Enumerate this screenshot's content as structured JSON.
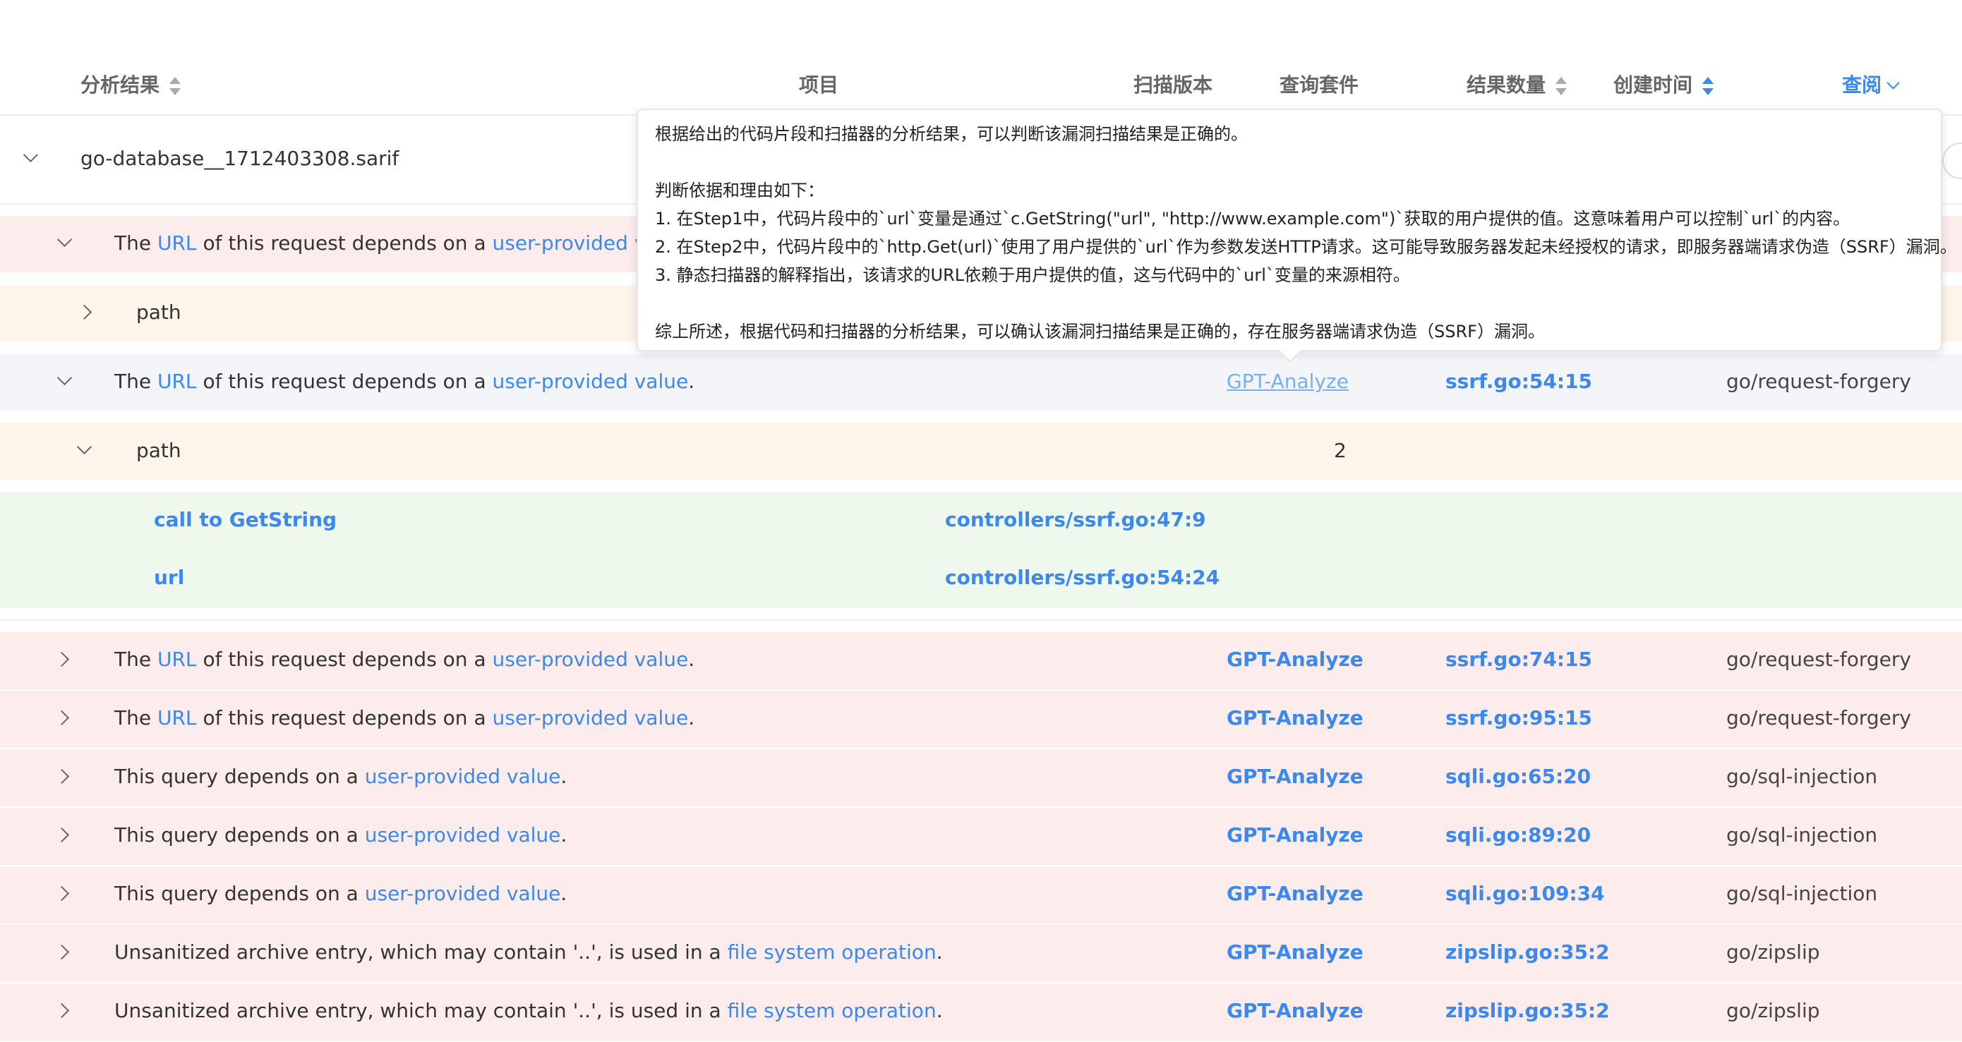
{
  "header": {
    "analysis_result": "分析结果",
    "project": "项目",
    "scan_version": "扫描版本",
    "query_suite": "查询套件",
    "result_count": "结果数量",
    "created_time": "创建时间",
    "view": "查阅"
  },
  "file": {
    "name": "go-database__1712403308.sarif"
  },
  "tooltip": {
    "lines": [
      "根据给出的代码片段和扫描器的分析结果，可以判断该漏洞扫描结果是正确的。",
      "判断依据和理由如下：",
      "1. 在Step1中，代码片段中的`url`变量是通过`c.GetString(\"url\", \"http://www.example.com\")`获取的用户提供的值。这意味着用户可以控制`url`的内容。",
      "2. 在Step2中，代码片段中的`http.Get(url)`使用了用户提供的`url`作为参数发送HTTP请求。这可能导致服务器发起未经授权的请求，即服务器端请求伪造（SSRF）漏洞。",
      "3. 静态扫描器的解释指出，该请求的URL依赖于用户提供的值，这与代码中的`url`变量的来源相符。",
      "综上所述，根据代码和扫描器的分析结果，可以确认该漏洞扫描结果是正确的，存在服务器端请求伪造（SSRF）漏洞。"
    ]
  },
  "result1": {
    "text_the": "The",
    "text_url": "URL",
    "text_mid": "of this request depends on a",
    "text_upv": "user-provided va"
  },
  "path1": {
    "label": "path"
  },
  "result2": {
    "text_the": "The",
    "text_url": "URL",
    "text_mid": "of this request depends on a",
    "text_upv": "user-provided value",
    "dot": ".",
    "analyze": "GPT-Analyze",
    "location": "ssrf.go:54:15",
    "rule": "go/request-forgery"
  },
  "path2": {
    "label": "path",
    "count": "2",
    "steps": [
      {
        "name": "call to GetString",
        "location": "controllers/ssrf.go:47:9"
      },
      {
        "name": "url",
        "location": "controllers/ssrf.go:54:24"
      }
    ]
  },
  "results": [
    {
      "pre": "The",
      "link1": "URL",
      "mid": "of this request depends on a",
      "link2": "user-provided value",
      "dot": ".",
      "analyze": "GPT-Analyze",
      "location": "ssrf.go:74:15",
      "rule": "go/request-forgery"
    },
    {
      "pre": "The",
      "link1": "URL",
      "mid": "of this request depends on a",
      "link2": "user-provided value",
      "dot": ".",
      "analyze": "GPT-Analyze",
      "location": "ssrf.go:95:15",
      "rule": "go/request-forgery"
    },
    {
      "pre": "This query depends on a",
      "link1": "",
      "mid": "",
      "link2": "user-provided value",
      "dot": ".",
      "analyze": "GPT-Analyze",
      "location": "sqli.go:65:20",
      "rule": "go/sql-injection"
    },
    {
      "pre": "This query depends on a",
      "link1": "",
      "mid": "",
      "link2": "user-provided value",
      "dot": ".",
      "analyze": "GPT-Analyze",
      "location": "sqli.go:89:20",
      "rule": "go/sql-injection"
    },
    {
      "pre": "This query depends on a",
      "link1": "",
      "mid": "",
      "link2": "user-provided value",
      "dot": ".",
      "analyze": "GPT-Analyze",
      "location": "sqli.go:109:34",
      "rule": "go/sql-injection"
    },
    {
      "pre": "Unsanitized archive entry, which may contain '..', is used in a",
      "link1": "",
      "mid": "",
      "link2": "file system operation",
      "dot": ".",
      "analyze": "GPT-Analyze",
      "location": "zipslip.go:35:2",
      "rule": "go/zipslip"
    },
    {
      "pre": "Unsanitized archive entry, which may contain '..', is used in a",
      "link1": "",
      "mid": "",
      "link2": "file system operation",
      "dot": ".",
      "analyze": "GPT-Analyze",
      "location": "zipslip.go:35:2",
      "rule": "go/zipslip"
    }
  ],
  "colors": {
    "link": "#3a88f0",
    "pink_row": "#fdecec",
    "peach_row": "#fdf4ea",
    "green_row": "#eef8ec",
    "gray_row": "#f3f5f9"
  }
}
